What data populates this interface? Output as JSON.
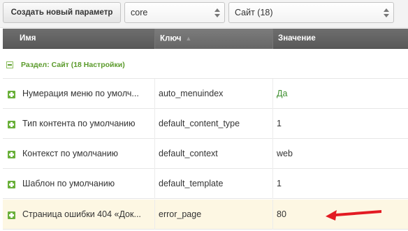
{
  "toolbar": {
    "create_button": "Создать новый параметр",
    "namespace_value": "core",
    "area_value": "Сайт (18)"
  },
  "grid": {
    "columns": {
      "name": "Имя",
      "key": "Ключ",
      "value": "Значение"
    },
    "group_label": "Раздел: Сайт (18 Настройки)",
    "rows": [
      {
        "name": "Нумерация меню по умолч...",
        "key": "auto_menuindex",
        "value": "Да"
      },
      {
        "name": "Тип контента по умолчанию",
        "key": "default_content_type",
        "value": "1"
      },
      {
        "name": "Контекст по умолчанию",
        "key": "default_context",
        "value": "web"
      },
      {
        "name": "Шаблон по умолчанию",
        "key": "default_template",
        "value": "1"
      },
      {
        "name": "Страница ошибки 404 «Док...",
        "key": "error_page",
        "value": "80"
      }
    ]
  },
  "colors": {
    "group_green": "#5a9a2a",
    "highlight_row": "#fdf7e3",
    "annotation_arrow": "#e31b23"
  },
  "icons": {
    "combo_arrows": "up-down-arrows-icon",
    "expand": "plus-square-icon",
    "collapse": "minus-square-icon",
    "annotation": "red-arrow-icon"
  }
}
